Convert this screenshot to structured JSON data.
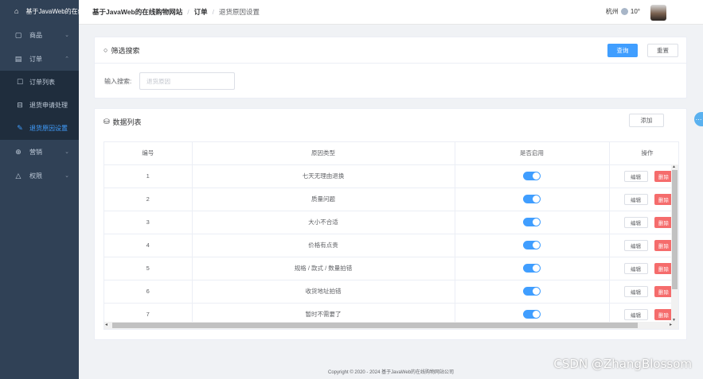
{
  "sidebar": {
    "home": "基于JavaWeb的在线购物网站",
    "items": [
      {
        "label": "商品",
        "icon": "shopping-bag-icon",
        "chevron": "⌄"
      },
      {
        "label": "订单",
        "icon": "order-icon",
        "chevron": "⌃"
      }
    ],
    "sub_items": [
      {
        "label": "订单列表",
        "icon": "edit-doc-icon"
      },
      {
        "label": "退货申请处理",
        "icon": "box-icon"
      },
      {
        "label": "退货原因设置",
        "icon": "edit-icon"
      }
    ],
    "items2": [
      {
        "label": "营销",
        "icon": "gift-icon",
        "chevron": "⌄"
      },
      {
        "label": "权限",
        "icon": "bell-icon",
        "chevron": "⌄"
      }
    ],
    "active_color": "#409eff"
  },
  "header": {
    "crumb_root": "基于JavaWeb的在线购物网站",
    "crumb_mid": "订单",
    "crumb_current": "退货原因设置",
    "city": "杭州",
    "temp": "10°"
  },
  "filter": {
    "title": "筛选搜索",
    "search_button": "查询",
    "reset_button": "重置",
    "input_label": "输入搜索:",
    "input_placeholder": "退货原因"
  },
  "list": {
    "title": "数据列表",
    "add_button": "添加",
    "columns": [
      "编号",
      "原因类型",
      "是否启用",
      "操作"
    ],
    "edit_label": "编辑",
    "delete_label": "删除",
    "rows": [
      {
        "id": "1",
        "reason": "七天无理由退换",
        "enabled": true
      },
      {
        "id": "2",
        "reason": "质量问题",
        "enabled": true
      },
      {
        "id": "3",
        "reason": "大小不合适",
        "enabled": true
      },
      {
        "id": "4",
        "reason": "价格有点贵",
        "enabled": true
      },
      {
        "id": "5",
        "reason": "规格 / 款式 / 数量拍错",
        "enabled": true
      },
      {
        "id": "6",
        "reason": "收货地址拍错",
        "enabled": true
      },
      {
        "id": "7",
        "reason": "暂时不需要了",
        "enabled": true
      }
    ]
  },
  "footer": "Copyright © 2020 - 2024  基于JavaWeb的在线购物网站公司",
  "watermark": "CSDN @ZhangBlossom",
  "colors": {
    "primary": "#409eff",
    "danger": "#f56c6c",
    "sidebar": "#304156"
  }
}
